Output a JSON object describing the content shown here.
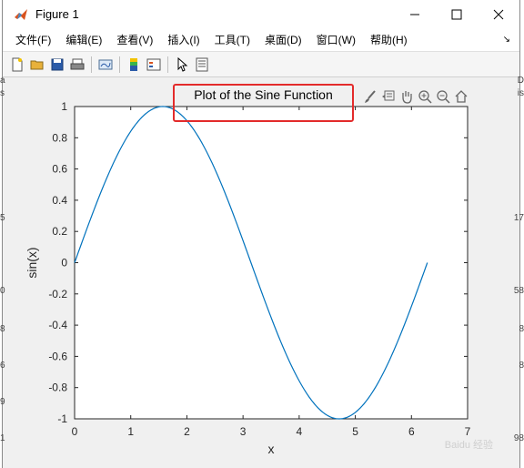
{
  "window": {
    "title": "Figure 1",
    "minimize": "—",
    "maximize": "☐",
    "close": "✕"
  },
  "menu": {
    "items": [
      "文件(F)",
      "编辑(E)",
      "查看(V)",
      "插入(I)",
      "工具(T)",
      "桌面(D)",
      "窗口(W)",
      "帮助(H)"
    ],
    "overflow": "↘"
  },
  "toolbar": {
    "icons": [
      "new-figure-icon",
      "open-icon",
      "save-icon",
      "print-icon",
      "link-plot-icon",
      "colorbar-icon",
      "legend-icon",
      "edit-plot-icon",
      "property-inspector-icon"
    ]
  },
  "axes_toolbar": {
    "icons": [
      "brush-icon",
      "data-tips-icon",
      "pan-icon",
      "zoom-in-icon",
      "zoom-out-icon",
      "home-icon"
    ]
  },
  "background_fragments": {
    "left": [
      "a",
      "s",
      "5",
      "0",
      "8",
      "6",
      "9",
      "1"
    ],
    "right": [
      "D",
      "is",
      "17",
      "58",
      "8",
      "8",
      "98"
    ]
  },
  "watermark": "Baidu 经验",
  "chart_data": {
    "type": "line",
    "title": "Plot of the Sine Function",
    "xlabel": "x",
    "ylabel": "sin(x)",
    "xlim": [
      0,
      7
    ],
    "ylim": [
      -1,
      1
    ],
    "xticks": [
      0,
      1,
      2,
      3,
      4,
      5,
      6,
      7
    ],
    "yticks": [
      -1,
      -0.8,
      -0.6,
      -0.4,
      -0.2,
      0,
      0.2,
      0.4,
      0.6,
      0.8,
      1
    ],
    "ytick_labels": [
      "-1",
      "-0.8",
      "-0.6",
      "-0.4",
      "-0.2",
      "0",
      "0.2",
      "0.4",
      "0.6",
      "0.8",
      "1"
    ],
    "series": [
      {
        "function": "sin(x)",
        "x_range": [
          0,
          6.2832
        ],
        "color": "#0072bd"
      }
    ],
    "grid": false,
    "legend": "none"
  },
  "highlight": {
    "color": "#e32b2b",
    "target": "title"
  }
}
